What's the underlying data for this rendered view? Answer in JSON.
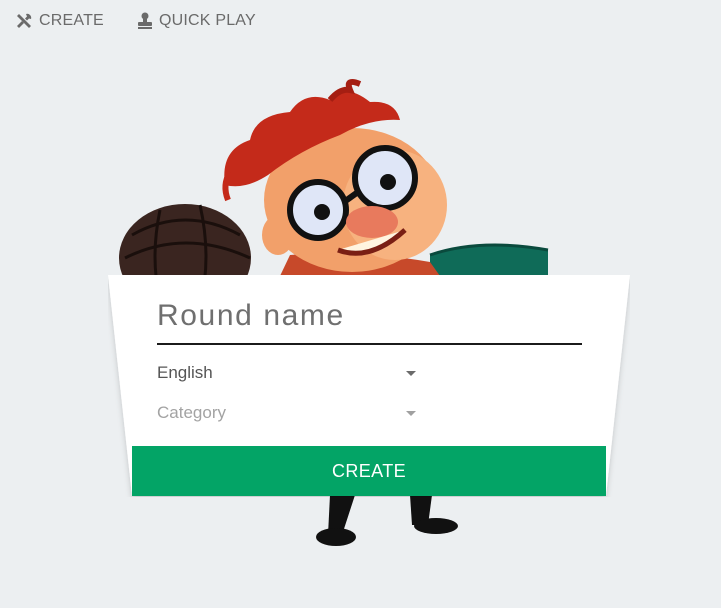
{
  "nav": {
    "create_label": "CREATE",
    "create_icon": "tools-icon",
    "quick_play_label": "QUICK PLAY",
    "quick_play_icon": "stamp-icon"
  },
  "form": {
    "round_name_placeholder": "Round name",
    "language_value": "English",
    "category_placeholder": "Category",
    "create_button_label": "CREATE"
  },
  "colors": {
    "background": "#eceff1",
    "accent_green": "#03a466",
    "nav_text": "#6a6a6a"
  }
}
